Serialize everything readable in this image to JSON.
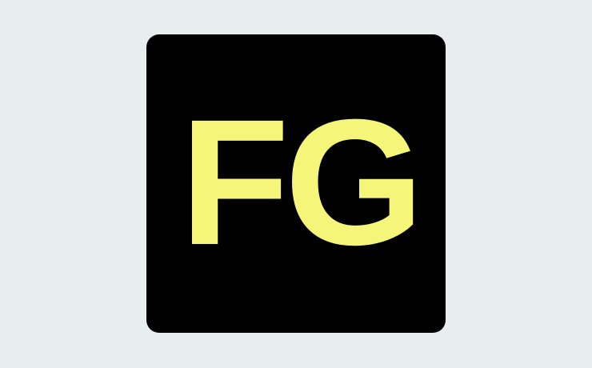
{
  "logo": {
    "text": "FG",
    "text_color": "#f5f57a",
    "tile_color": "#000000"
  },
  "page": {
    "background_color": "#e8edf0"
  }
}
